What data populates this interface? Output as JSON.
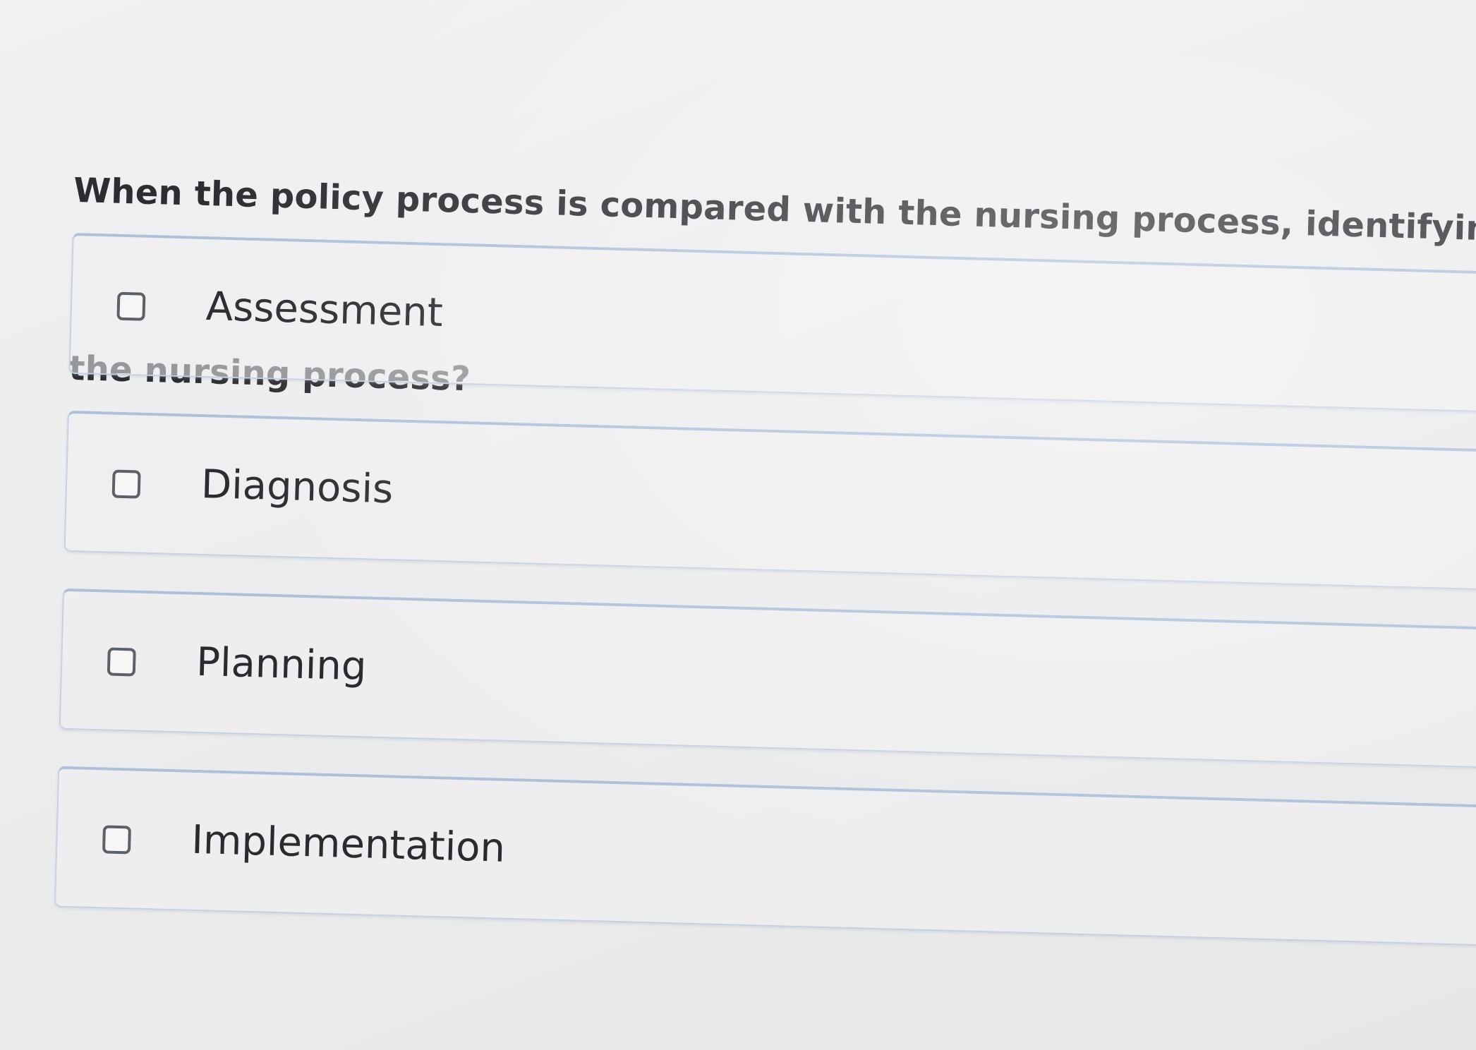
{
  "question": {
    "line1": "When the policy process is compared with the nursing process, identifying the is",
    "line2": "the nursing process?"
  },
  "options": [
    {
      "label": "Assessment",
      "checked": false
    },
    {
      "label": "Diagnosis",
      "checked": false
    },
    {
      "label": "Planning",
      "checked": false
    },
    {
      "label": "Implementation",
      "checked": false
    }
  ]
}
